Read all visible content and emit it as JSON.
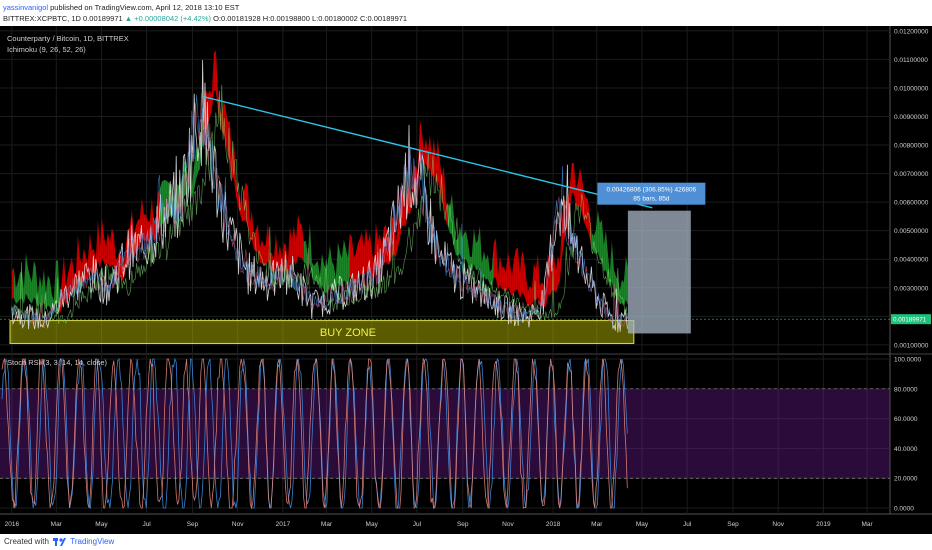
{
  "header": {
    "author": "yassinvanigol",
    "published": "published on TradingView.com, April 12, 2018 13:10 EST",
    "symbol": "BITTREX:XCPBTC, 1D",
    "open": "0.00189971",
    "change": "+0.00008042 (+4.42%)",
    "o": "O:0.00181928",
    "h": "H:0.00198800",
    "l": "L:0.00180002",
    "c": "C:0.00189971"
  },
  "colors": {
    "background": "#000000",
    "cloud_bearish": "#d60000",
    "cloud_bullish": "#1f8a2a",
    "trendline": "#29c6e6",
    "buy_zone": "#c8c800",
    "stoch_band": "#7b1fa2",
    "stoch_k": "#3d8fe8",
    "stoch_d": "#e9867a",
    "last_price_tag": "#1ec07c",
    "measure_box": "#4f8fd6"
  },
  "chart_data": [
    {
      "type": "line",
      "title": "Counterparty / Bitcoin, 1D, BITTREX",
      "indicator_label": "Ichimoku (9, 26, 52, 26)",
      "ylim": [
        0.00075,
        0.0121
      ],
      "y_ticks": [
        "0.01200000",
        "0.01100000",
        "0.01000000",
        "0.00900000",
        "0.00800000",
        "0.00700000",
        "0.00600000",
        "0.00500000",
        "0.00400000",
        "0.00300000",
        "0.00200000",
        "0.00100000"
      ],
      "last_price": "0.00189971",
      "series": [
        {
          "values_x": [
            "2016-01-01",
            "2016-02-15",
            "2016-03-15",
            "2016-04-15",
            "2016-05-10",
            "2016-06-05",
            "2016-07-01",
            "2016-07-25",
            "2016-08-15",
            "2016-09-05",
            "2016-09-12",
            "2016-10-01",
            "2016-10-20",
            "2016-11-15",
            "2016-12-15",
            "2017-01-10",
            "2017-02-10",
            "2017-03-10",
            "2017-04-10",
            "2017-05-10",
            "2017-06-05",
            "2017-06-20",
            "2017-07-10",
            "2017-08-01",
            "2017-09-01",
            "2017-10-01",
            "2017-11-01",
            "2017-12-01",
            "2017-12-20",
            "2018-01-08",
            "2018-01-25",
            "2018-02-15",
            "2018-03-05",
            "2018-03-25",
            "2018-04-12"
          ],
          "values_y": [
            0.0022,
            0.0018,
            0.0028,
            0.0035,
            0.003,
            0.0042,
            0.0045,
            0.0055,
            0.006,
            0.0085,
            0.0095,
            0.007,
            0.005,
            0.0035,
            0.0032,
            0.0036,
            0.0024,
            0.0027,
            0.003,
            0.0035,
            0.0055,
            0.0072,
            0.0062,
            0.004,
            0.0032,
            0.0027,
            0.0022,
            0.002,
            0.0026,
            0.006,
            0.0048,
            0.0034,
            0.0025,
            0.0018,
            0.0019
          ]
        }
      ],
      "annotations": [
        {
          "type": "trendline",
          "x": [
            "2016-09-15",
            "2018-05-15"
          ],
          "y": [
            0.0097,
            0.0058
          ]
        },
        {
          "type": "zone",
          "label": "BUY ZONE",
          "x": [
            "2015-12-15",
            "2018-04-20"
          ],
          "y": [
            0.00105,
            0.00185
          ]
        },
        {
          "type": "measure",
          "label_line1": "0.00426806 (306.85%) 426806",
          "label_line2": "85 bars, 85d",
          "x": [
            "2018-04-12",
            "2018-07-06"
          ],
          "y": [
            0.0014,
            0.0057
          ]
        }
      ]
    },
    {
      "type": "line",
      "indicator_label": "Stoch RSI (3, 3, 14, 14, close)",
      "ylim": [
        -4,
        102
      ],
      "y_ticks": [
        "100.0000",
        "80.0000",
        "60.0000",
        "40.0000",
        "20.0000",
        "0.0000"
      ],
      "band": [
        20,
        80
      ]
    }
  ],
  "x_ticks": [
    "2016",
    "Mar",
    "May",
    "Jul",
    "Sep",
    "Nov",
    "2017",
    "Mar",
    "May",
    "Jul",
    "Sep",
    "Nov",
    "2018",
    "Mar",
    "May",
    "Jul",
    "Sep",
    "Nov",
    "2019",
    "Mar"
  ],
  "footer": {
    "created_with": "Created with",
    "brand": "TradingView"
  }
}
